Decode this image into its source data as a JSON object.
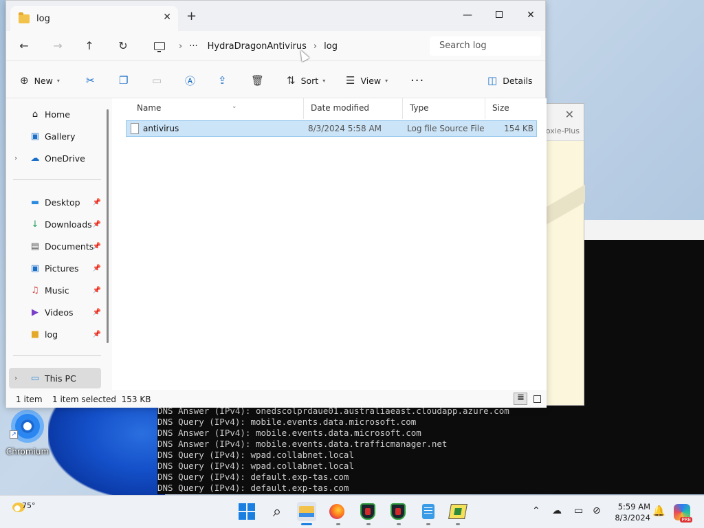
{
  "explorer": {
    "tab_title": "log",
    "breadcrumb": [
      "HydraDragonAntivirus",
      "log"
    ],
    "search_placeholder": "Search log",
    "commands": {
      "new": "New",
      "sort": "Sort",
      "view": "View",
      "details": "Details"
    },
    "sidebar": {
      "top": [
        "Home",
        "Gallery",
        "OneDrive"
      ],
      "pinned": [
        "Desktop",
        "Downloads",
        "Documents",
        "Pictures",
        "Music",
        "Videos",
        "log"
      ],
      "this_pc": "This PC"
    },
    "columns": [
      "Name",
      "Date modified",
      "Type",
      "Size"
    ],
    "files": [
      {
        "name": "antivirus",
        "date": "8/3/2024 5:58 AM",
        "type": "Log file Source File",
        "size": "154 KB"
      }
    ],
    "status": {
      "count": "1 item",
      "selection": "1 item selected  153 KB"
    }
  },
  "background_window": {
    "title_fragment": "oxie-Plus"
  },
  "desktop": {
    "icon_label": "Chromium"
  },
  "terminal": {
    "lines": [
      "DNS Answer (IPv4): onedscolprdaue01.australiaeast.cloudapp.azure.com",
      "DNS Query (IPv4): mobile.events.data.microsoft.com",
      "DNS Answer (IPv4): mobile.events.data.microsoft.com",
      "DNS Answer (IPv4): mobile.events.data.trafficmanager.net",
      "DNS Query (IPv4): wpad.collabnet.local",
      "DNS Query (IPv4): wpad.collabnet.local",
      "DNS Query (IPv4): default.exp-tas.com",
      "DNS Query (IPv4): default.exp-tas.com"
    ]
  },
  "taskbar": {
    "weather_temp": "75°",
    "time": "5:59 AM",
    "date": "8/3/2024",
    "copilot_badge": "PRE"
  }
}
